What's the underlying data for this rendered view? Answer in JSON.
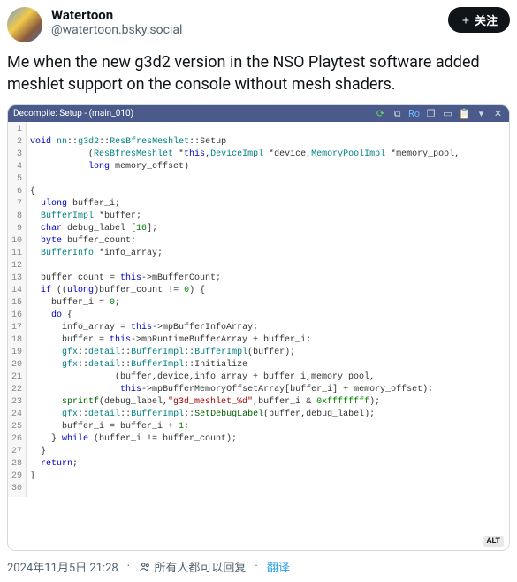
{
  "user": {
    "display_name": "Watertoon",
    "handle": "@watertoon.bsky.social"
  },
  "follow_label": "关注",
  "post_body": "Me when the new g3d2 version in the NSO Playtest software added meshlet support on the console without mesh shaders.",
  "tab": {
    "label": "Decompile: Setup - (main_010)"
  },
  "toolbar_ro": "Ro",
  "code": {
    "lines": [
      "",
      "void nn::g3d2::ResBfresMeshlet::Setup",
      "           (ResBfresMeshlet *this,DeviceImpl *device,MemoryPoolImpl *memory_pool,",
      "           long memory_offset)",
      "",
      "{",
      "  ulong buffer_i;",
      "  BufferImpl *buffer;",
      "  char debug_label [16];",
      "  byte buffer_count;",
      "  BufferInfo *info_array;",
      "",
      "  buffer_count = this->mBufferCount;",
      "  if ((ulong)buffer_count != 0) {",
      "    buffer_i = 0;",
      "    do {",
      "      info_array = this->mpBufferInfoArray;",
      "      buffer = this->mpRuntimeBufferArray + buffer_i;",
      "      gfx::detail::BufferImpl::BufferImpl(buffer);",
      "      gfx::detail::BufferImpl::Initialize",
      "                (buffer,device,info_array + buffer_i,memory_pool,",
      "                 this->mpBufferMemoryOffsetArray[buffer_i] + memory_offset);",
      "      sprintf(debug_label,\"g3d_meshlet_%d\",buffer_i & 0xffffffff);",
      "      gfx::detail::BufferImpl::SetDebugLabel(buffer,debug_label);",
      "      buffer_i = buffer_i + 1;",
      "    } while (buffer_i != buffer_count);",
      "  }",
      "  return;",
      "}",
      ""
    ]
  },
  "alt_badge": "ALT",
  "footer": {
    "timestamp": "2024年11月5日 21:28",
    "reply_scope": "所有人都可以回复",
    "translate": "翻译",
    "sep": "·"
  }
}
